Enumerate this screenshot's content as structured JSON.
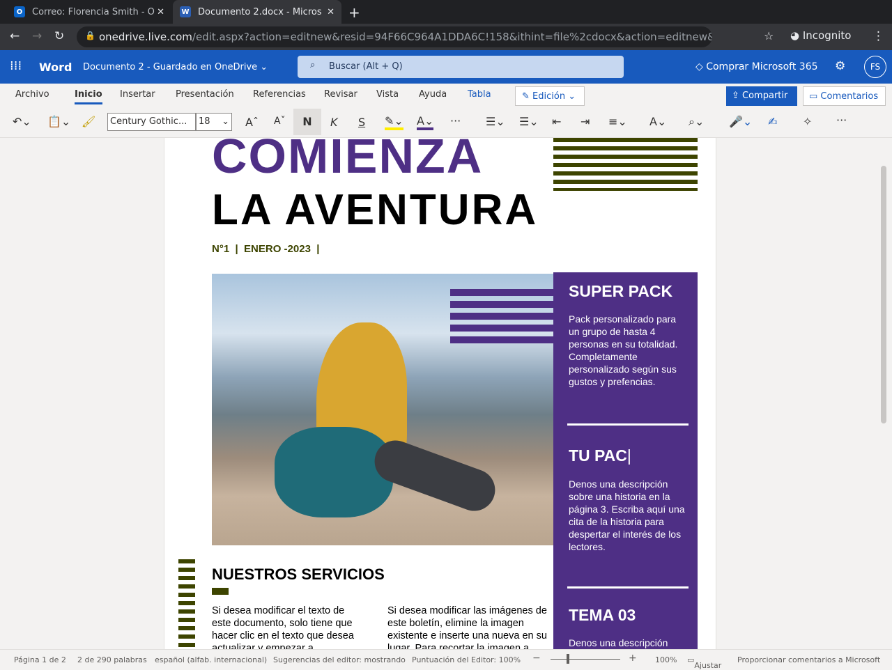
{
  "browser": {
    "tabs": [
      {
        "title": "Correo: Florencia Smith - O",
        "icon": "outlook-icon"
      },
      {
        "title": "Documento 2.docx - Micros",
        "icon": "word-icon"
      }
    ],
    "url_host": "onedrive.live.com",
    "url_path": "/edit.aspx?action=editnew&resid=94F66C964A1DDA6C!158&ithint=file%2cdocx&action=editnew&wd...",
    "incognito": "Incognito"
  },
  "app": {
    "name": "Word",
    "doc": "Documento 2",
    "sep": "-",
    "saved": "Guardado en OneDrive",
    "search": "Buscar (Alt + Q)",
    "buy": "Comprar Microsoft 365",
    "avatar": "FS"
  },
  "ribbon": {
    "tabs": [
      "Archivo",
      "Inicio",
      "Insertar",
      "Presentación",
      "Referencias",
      "Revisar",
      "Vista",
      "Ayuda",
      "Tabla"
    ],
    "mode": "Edición",
    "share": "Compartir",
    "comments": "Comentarios",
    "font": "Century Gothic...",
    "size": "18",
    "bold": "N",
    "italic": "K",
    "strike": "S",
    "more": "···"
  },
  "doc": {
    "title1": "COMIENZA",
    "title2": "LA AVENTURA",
    "meta": "N°1  |  ENERO -2023  |",
    "sidebar": [
      {
        "heading": "SUPER PACK",
        "text": "Pack personalizado para un grupo de hasta 4 personas en su totalidad. Completamente personalizado según sus gustos y prefencias."
      },
      {
        "heading": "TU PAC",
        "text": "Denos una descripción sobre una historia en la página 3. Escriba aquí una cita de la historia para despertar el interés de los lectores."
      },
      {
        "heading": "TEMA 03",
        "text": "Denos una descripción"
      }
    ],
    "section": "NUESTROS SERVICIOS",
    "col1": "Si desea modificar el texto de este documento, solo tiene que hacer clic en el texto que desea actualizar y empezar a",
    "col2": "Si desea modificar las imágenes de este boletín, elimine la imagen existente e inserte una nueva en su lugar. Para recortar la imagen a"
  },
  "status": {
    "page": "Página 1 de 2",
    "words": "2 de 290 palabras",
    "lang": "español (alfab. internacional)",
    "suggest": "Sugerencias del editor: mostrando",
    "score": "Puntuación del Editor: 100%",
    "zoom": "100%",
    "fit": "Ajustar",
    "feedback": "Proporcionar comentarios a Microsoft"
  },
  "colors": {
    "accent": "#185abd",
    "purple": "#4e2f85",
    "olive": "#3d4400"
  }
}
